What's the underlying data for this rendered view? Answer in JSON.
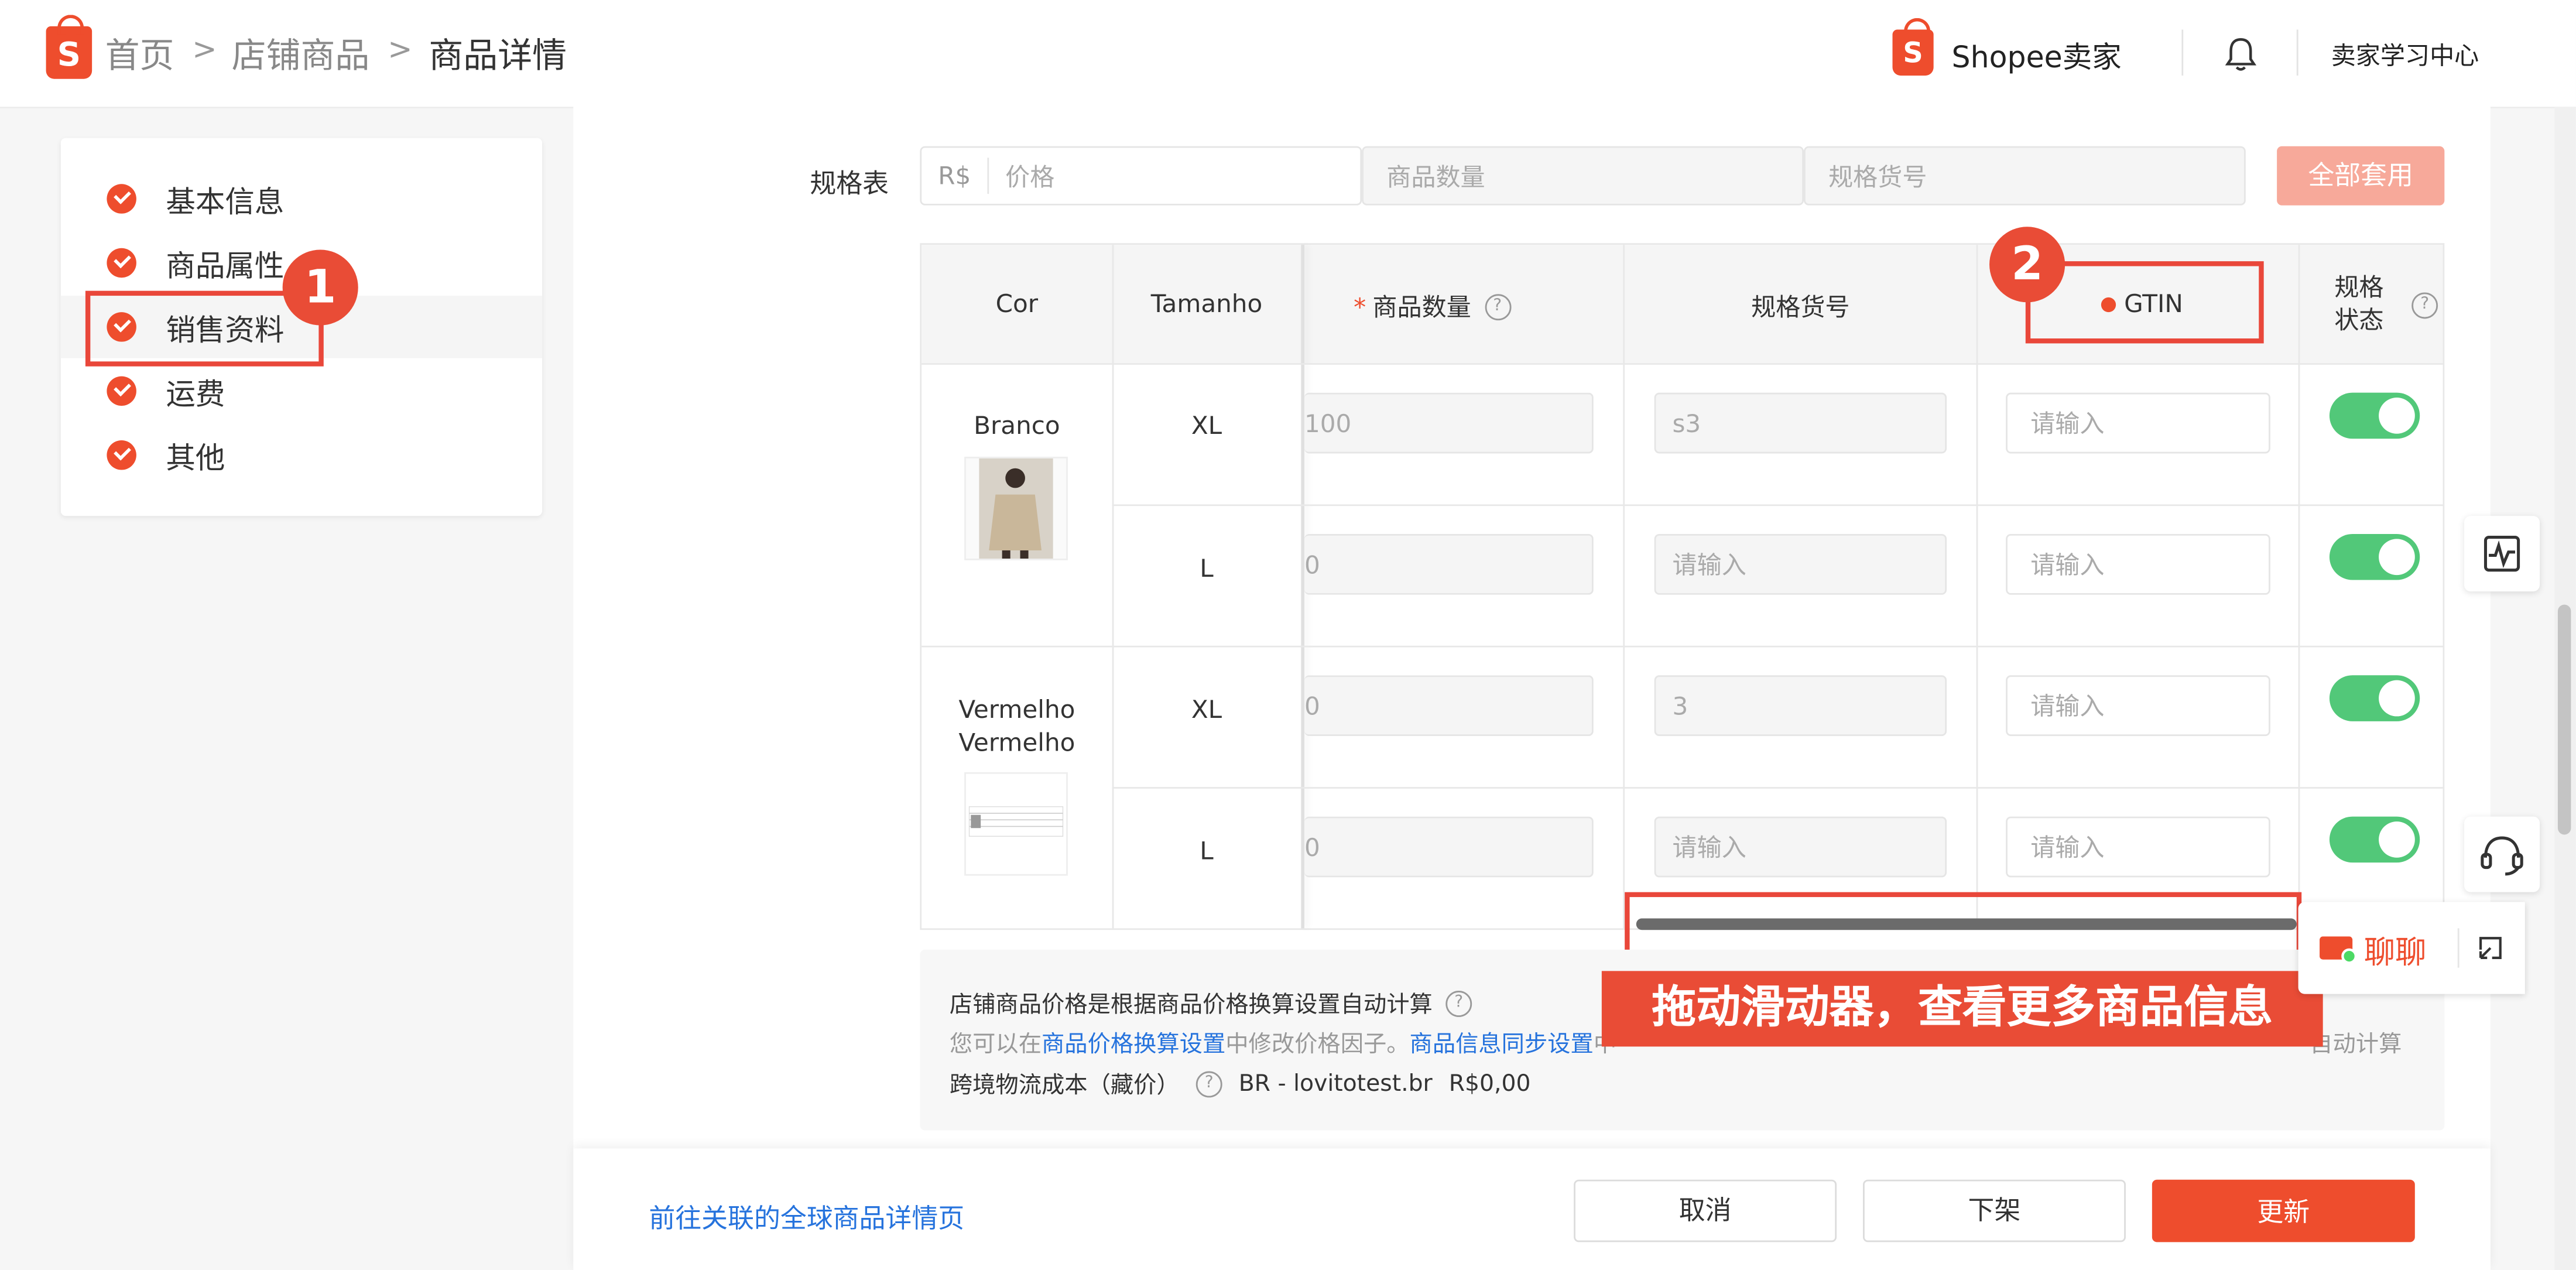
{
  "breadcrumb": {
    "home": "首页",
    "shop_products": "店铺商品",
    "current": "商品详情",
    "sep": ">"
  },
  "header": {
    "brand": "Shopee卖家",
    "learning_center": "卖家学习中心",
    "logo_letter": "S"
  },
  "sidebar": {
    "items": [
      {
        "label": "基本信息"
      },
      {
        "label": "商品属性"
      },
      {
        "label": "销售资料"
      },
      {
        "label": "运费"
      },
      {
        "label": "其他"
      }
    ]
  },
  "spec_table": {
    "label": "规格表",
    "currency": "R$",
    "price_placeholder": "价格",
    "qty_placeholder": "商品数量",
    "sku_placeholder": "规格货号",
    "apply_all": "全部套用"
  },
  "table": {
    "headers": {
      "cor": "Cor",
      "tamanho": "Tamanho",
      "required_mark": "*",
      "qty": "商品数量",
      "sku": "规格货号",
      "gtin": "GTIN",
      "status_line1": "规格",
      "status_line2": "状态"
    },
    "colors": [
      {
        "name": "Branco",
        "name2": ""
      },
      {
        "name": "Vermelho",
        "name2": "Vermelho"
      }
    ],
    "rows": [
      {
        "size": "XL",
        "qty": "100",
        "sku": "s3",
        "gtin_placeholder": "请输入"
      },
      {
        "size": "L",
        "qty": "0",
        "sku": "请输入",
        "gtin_placeholder": "请输入"
      },
      {
        "size": "XL",
        "qty": "0",
        "sku": "3",
        "gtin_placeholder": "请输入"
      },
      {
        "size": "L",
        "qty": "0",
        "sku": "请输入",
        "gtin_placeholder": "请输入"
      }
    ]
  },
  "annotations": {
    "badge1": "1",
    "badge2": "2",
    "tip": "拖动滑动器，查看更多商品信息"
  },
  "info": {
    "line1": "店铺商品价格是根据商品价格换算设置自动计算",
    "line2_prefix": "您可以在",
    "line2_link1": "商品价格换算设置",
    "line2_mid": "中修改价格因子。",
    "line2_link2": "商品信息同步设置",
    "line2_tail": "中",
    "line2_right": "自动计算",
    "line3_label": "跨境物流成本（藏价）",
    "line3_store": "BR - lovitotest.br",
    "line3_value": "R$0,00",
    "q": "?"
  },
  "footer": {
    "global_link": "前往关联的全球商品详情页",
    "cancel": "取消",
    "unlist": "下架",
    "update": "更新"
  },
  "chat": {
    "label": "聊聊"
  },
  "colors": {
    "accent": "#ee4d2d",
    "toggle_on": "#52c879",
    "link": "#2673dd"
  }
}
